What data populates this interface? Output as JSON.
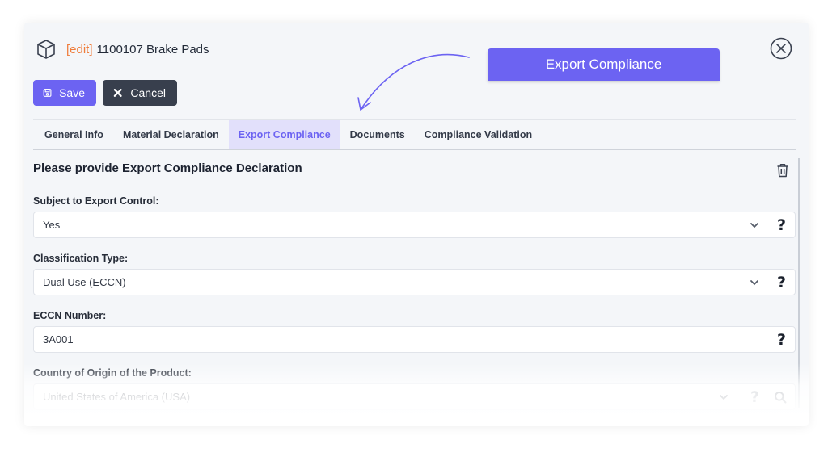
{
  "header": {
    "edit_tag": "[edit]",
    "title": "1100107 Brake Pads"
  },
  "toolbar": {
    "save_label": "Save",
    "cancel_label": "Cancel"
  },
  "callout": {
    "label": "Export Compliance"
  },
  "tabs": [
    {
      "label": "General Info",
      "active": false
    },
    {
      "label": "Material Declaration",
      "active": false
    },
    {
      "label": "Export Compliance",
      "active": true
    },
    {
      "label": "Documents",
      "active": false
    },
    {
      "label": "Compliance Validation",
      "active": false
    }
  ],
  "section": {
    "title": "Please provide Export Compliance Declaration"
  },
  "fields": {
    "export_control": {
      "label": "Subject to Export Control:",
      "value": "Yes"
    },
    "classification_type": {
      "label": "Classification Type:",
      "value": "Dual Use (ECCN)"
    },
    "eccn_number": {
      "label": "ECCN Number:",
      "value": "3A001"
    },
    "country_origin": {
      "label": "Country of Origin of the Product:",
      "value": "United States of America (USA)"
    }
  },
  "help_glyph": "?",
  "colors": {
    "accent": "#6c63f2",
    "edit_tag": "#ef7d3c",
    "cancel_bg": "#383f4d",
    "active_tab_bg": "#e2e0fb"
  },
  "icons": {
    "title": "package-box-icon",
    "close": "close-circle-icon",
    "save": "save-disk-icon",
    "cancel": "x-icon",
    "delete": "trash-icon",
    "dropdown": "chevron-down-icon",
    "help": "question-mark-icon",
    "search": "search-icon"
  }
}
